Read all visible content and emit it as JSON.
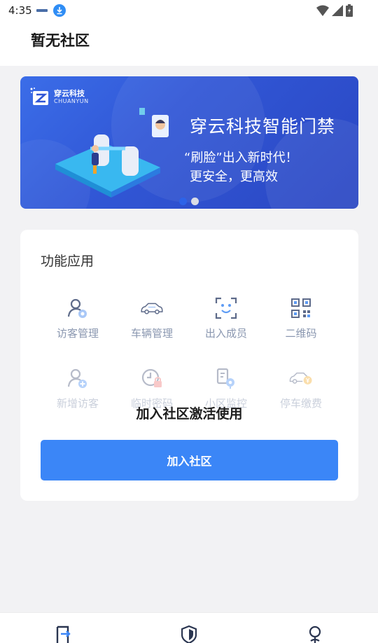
{
  "status_bar": {
    "time": "4:35"
  },
  "header": {
    "title": "暂无社区"
  },
  "banner": {
    "logo_cn": "穿云科技",
    "logo_en": "CHUANYUN",
    "headline": "穿云科技智能门禁",
    "line1": "“刷脸”出入新时代！",
    "line2": "更安全，更高效",
    "active_slide": 2,
    "slide_count": 2
  },
  "functions": {
    "title": "功能应用",
    "items": [
      {
        "label": "访客管理",
        "icon": "visitor-manage-icon"
      },
      {
        "label": "车辆管理",
        "icon": "car-icon"
      },
      {
        "label": "出入成员",
        "icon": "face-scan-icon"
      },
      {
        "label": "二维码",
        "icon": "qr-code-icon"
      },
      {
        "label": "新增访客",
        "icon": "add-visitor-icon"
      },
      {
        "label": "临时密码",
        "icon": "temp-password-icon"
      },
      {
        "label": "小区监控",
        "icon": "monitor-icon"
      },
      {
        "label": "停车缴费",
        "icon": "parking-pay-icon"
      }
    ],
    "overlay_text": "加入社区激活使用",
    "join_button": "加入社区"
  },
  "colors": {
    "accent": "#3b86f7",
    "icon": "#8a97b0",
    "banner": "#3157d6"
  },
  "bottom_nav": {
    "items": [
      {
        "icon": "door-access-icon",
        "active": true
      },
      {
        "icon": "shield-icon",
        "active": false
      },
      {
        "icon": "profile-icon",
        "active": false
      }
    ]
  }
}
